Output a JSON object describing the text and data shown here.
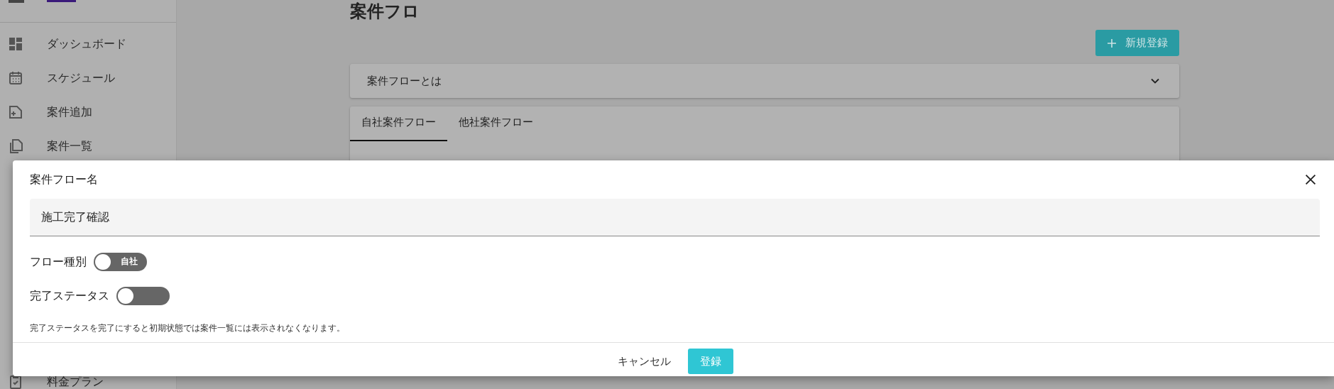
{
  "sidebar": {
    "items": [
      {
        "label": "ダッシュボード",
        "kind": "dashboard"
      },
      {
        "label": "スケジュール",
        "kind": "calendar"
      },
      {
        "label": "案件追加",
        "kind": "add"
      },
      {
        "label": "案件一覧",
        "kind": "list"
      },
      {
        "label": "料金プラン",
        "kind": "plan"
      }
    ]
  },
  "page": {
    "title": "案件フロ",
    "new_button": "新規登録",
    "accordion": {
      "label": "案件フローとは",
      "expanded": false
    },
    "tabs": [
      {
        "label": "自社案件フロー",
        "selected": true
      },
      {
        "label": "他社案件フロー",
        "selected": false
      }
    ]
  },
  "dialog": {
    "field_label": "案件フロー名",
    "field_value": "施工完了確認",
    "switches": [
      {
        "label": "フロー種別",
        "on": false,
        "text": "自社"
      },
      {
        "label": "完了ステータス",
        "on": false
      }
    ],
    "note": "完了ステータスを完了にすると初期状態では案件一覧には表示されなくなります。",
    "cancel": "キャンセル",
    "submit": "登録"
  }
}
